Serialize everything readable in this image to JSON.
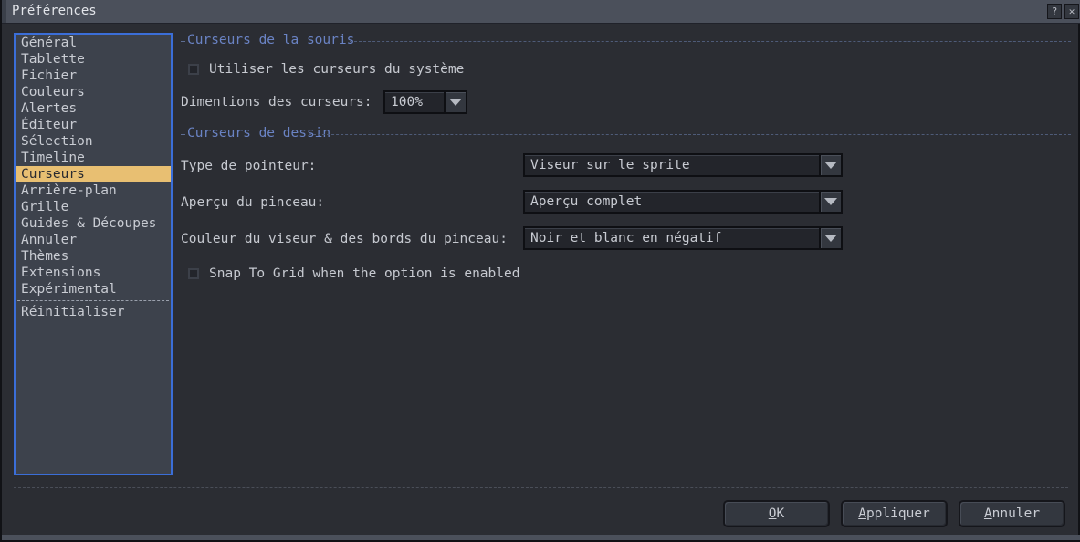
{
  "window": {
    "title": "Préférences",
    "titlebar_buttons": [
      {
        "name": "help-button",
        "glyph": "?"
      },
      {
        "name": "close-button",
        "glyph": "✕"
      }
    ],
    "colors": {
      "titlebar": "#4b505b",
      "body": "#2b2d33",
      "selection": "#e8bf72",
      "focus_border": "#3b6ed8",
      "group_header_text": "#6a83c4"
    }
  },
  "sidebar": {
    "selected": "Curseurs",
    "items": [
      {
        "label": "Général",
        "selected": false
      },
      {
        "label": "Tablette",
        "selected": false
      },
      {
        "label": "Fichier",
        "selected": false
      },
      {
        "label": "Couleurs",
        "selected": false
      },
      {
        "label": "Alertes",
        "selected": false
      },
      {
        "label": "Éditeur",
        "selected": false
      },
      {
        "label": "Sélection",
        "selected": false
      },
      {
        "label": "Timeline",
        "selected": false
      },
      {
        "label": "Curseurs",
        "selected": true
      },
      {
        "label": "Arrière-plan",
        "selected": false
      },
      {
        "label": "Grille",
        "selected": false
      },
      {
        "label": "Guides & Découpes",
        "selected": false
      },
      {
        "label": "Annuler",
        "selected": false
      },
      {
        "label": "Thèmes",
        "selected": false
      },
      {
        "label": "Extensions",
        "selected": false
      },
      {
        "label": "Expérimental",
        "selected": false
      }
    ],
    "footer_items": [
      {
        "label": "Réinitialiser"
      }
    ]
  },
  "main": {
    "groups": {
      "mouse_cursors": {
        "title": "Curseurs de la souris"
      },
      "drawing_cursors": {
        "title": "Curseurs de dessin"
      }
    },
    "use_system_cursors": {
      "label": "Utiliser les curseurs du système",
      "checked": false
    },
    "cursor_size": {
      "label": "Dimentions des curseurs:",
      "value": "100%"
    },
    "pointer_type": {
      "label": "Type de pointeur:",
      "value": "Viseur sur le sprite"
    },
    "brush_preview": {
      "label": "Aperçu du pinceau:",
      "value": "Aperçu complet"
    },
    "crosshair_color": {
      "label": "Couleur du viseur & des bords du pinceau:",
      "value": "Noir et blanc en négatif"
    },
    "snap_to_grid": {
      "label": "Snap To Grid when the option is enabled",
      "checked": false
    }
  },
  "footer": {
    "buttons": [
      {
        "name": "ok-button",
        "accel": "O",
        "rest": "K"
      },
      {
        "name": "apply-button",
        "accel": "A",
        "rest": "ppliquer"
      },
      {
        "name": "cancel-button",
        "accel": "A",
        "rest": "nnuler"
      }
    ]
  }
}
